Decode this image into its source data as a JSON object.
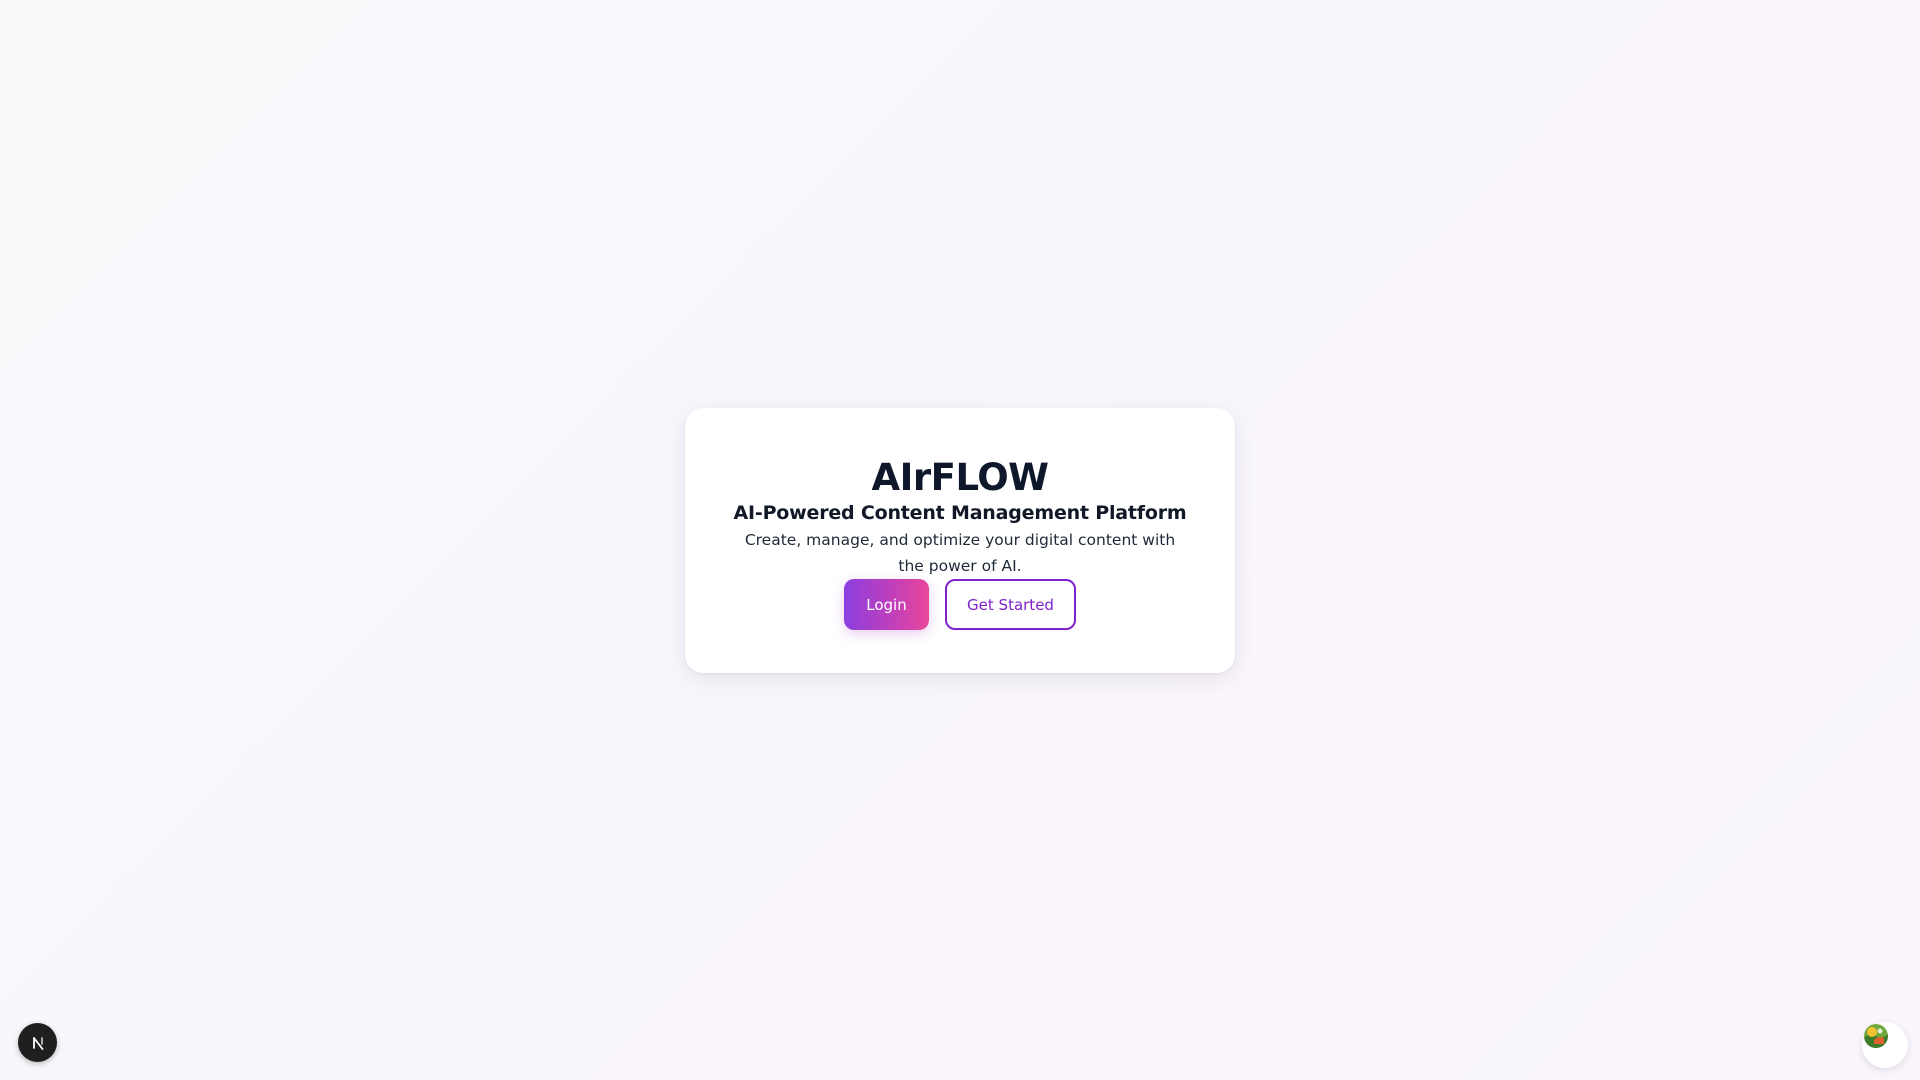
{
  "hero": {
    "title": "AIrFLOW",
    "subtitle": "AI-Powered Content Management Platform",
    "description": "Create, manage, and optimize your digital content with the power of AI."
  },
  "actions": {
    "login_label": "Login",
    "get_started_label": "Get Started"
  },
  "colors": {
    "primary_gradient_start": "#8b3fe0",
    "primary_gradient_end": "#e8489a",
    "accent_purple": "#7e22ce",
    "page_background": "#f9f8fb",
    "card_background": "#ffffff"
  },
  "icons": {
    "dev_badge": "nextjs-logo-icon",
    "assistant": "assistant-avatar-icon"
  }
}
